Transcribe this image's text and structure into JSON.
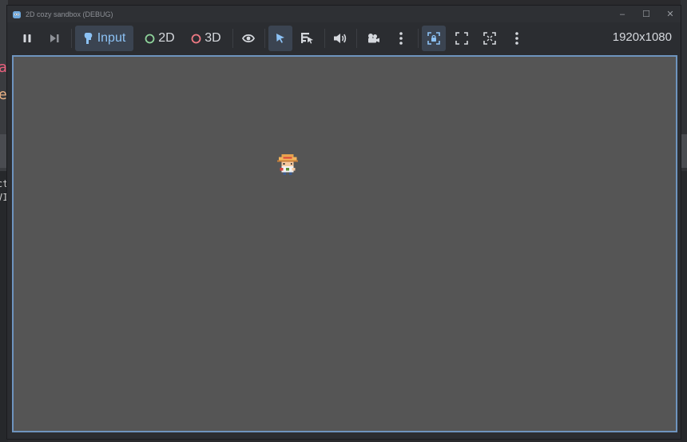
{
  "background_editor": {
    "glyph_1": "a",
    "glyph_2": "e",
    "code_1": "ct",
    "code_2": "VI"
  },
  "window": {
    "title": "2D cozy sandbox (DEBUG)",
    "minimize_glyph": "–",
    "maximize_glyph": "☐",
    "close_glyph": "✕"
  },
  "toolbar": {
    "input_label": "Input",
    "mode_2d_label": "2D",
    "mode_3d_label": "3D",
    "resolution": "1920x1080"
  },
  "colors": {
    "accent": "#8cc2f5",
    "viewport_bg": "#555555",
    "viewport_border": "#6e94be",
    "mode_2d": "#8fd49b",
    "mode_3d": "#f07a84"
  }
}
